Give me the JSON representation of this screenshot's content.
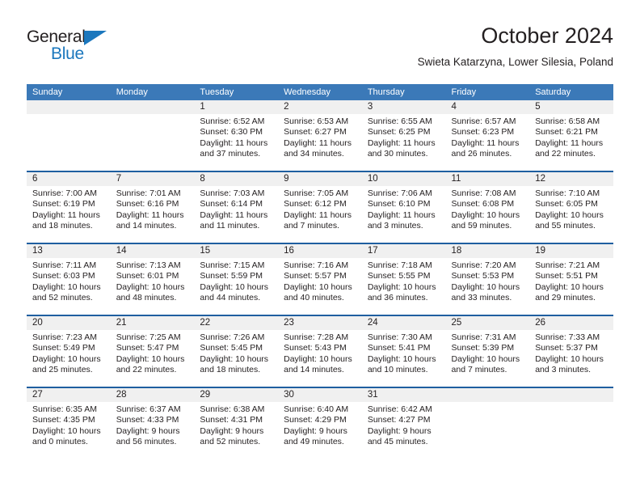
{
  "brand": {
    "name_part1": "General",
    "name_part2": "Blue",
    "logo_icon": "triangle-icon"
  },
  "header": {
    "title": "October 2024",
    "subtitle": "Swieta Katarzyna, Lower Silesia, Poland"
  },
  "colors": {
    "header_blue": "#3b79b8",
    "rule_blue": "#1f5fa0",
    "daynum_band": "#f0f0f0",
    "brand_blue": "#1b77bd",
    "text": "#231f20"
  },
  "weekdays": [
    "Sunday",
    "Monday",
    "Tuesday",
    "Wednesday",
    "Thursday",
    "Friday",
    "Saturday"
  ],
  "weeks": [
    [
      {
        "day": "",
        "lines": []
      },
      {
        "day": "",
        "lines": []
      },
      {
        "day": "1",
        "lines": [
          "Sunrise: 6:52 AM",
          "Sunset: 6:30 PM",
          "Daylight: 11 hours",
          "and 37 minutes."
        ]
      },
      {
        "day": "2",
        "lines": [
          "Sunrise: 6:53 AM",
          "Sunset: 6:27 PM",
          "Daylight: 11 hours",
          "and 34 minutes."
        ]
      },
      {
        "day": "3",
        "lines": [
          "Sunrise: 6:55 AM",
          "Sunset: 6:25 PM",
          "Daylight: 11 hours",
          "and 30 minutes."
        ]
      },
      {
        "day": "4",
        "lines": [
          "Sunrise: 6:57 AM",
          "Sunset: 6:23 PM",
          "Daylight: 11 hours",
          "and 26 minutes."
        ]
      },
      {
        "day": "5",
        "lines": [
          "Sunrise: 6:58 AM",
          "Sunset: 6:21 PM",
          "Daylight: 11 hours",
          "and 22 minutes."
        ]
      }
    ],
    [
      {
        "day": "6",
        "lines": [
          "Sunrise: 7:00 AM",
          "Sunset: 6:19 PM",
          "Daylight: 11 hours",
          "and 18 minutes."
        ]
      },
      {
        "day": "7",
        "lines": [
          "Sunrise: 7:01 AM",
          "Sunset: 6:16 PM",
          "Daylight: 11 hours",
          "and 14 minutes."
        ]
      },
      {
        "day": "8",
        "lines": [
          "Sunrise: 7:03 AM",
          "Sunset: 6:14 PM",
          "Daylight: 11 hours",
          "and 11 minutes."
        ]
      },
      {
        "day": "9",
        "lines": [
          "Sunrise: 7:05 AM",
          "Sunset: 6:12 PM",
          "Daylight: 11 hours",
          "and 7 minutes."
        ]
      },
      {
        "day": "10",
        "lines": [
          "Sunrise: 7:06 AM",
          "Sunset: 6:10 PM",
          "Daylight: 11 hours",
          "and 3 minutes."
        ]
      },
      {
        "day": "11",
        "lines": [
          "Sunrise: 7:08 AM",
          "Sunset: 6:08 PM",
          "Daylight: 10 hours",
          "and 59 minutes."
        ]
      },
      {
        "day": "12",
        "lines": [
          "Sunrise: 7:10 AM",
          "Sunset: 6:05 PM",
          "Daylight: 10 hours",
          "and 55 minutes."
        ]
      }
    ],
    [
      {
        "day": "13",
        "lines": [
          "Sunrise: 7:11 AM",
          "Sunset: 6:03 PM",
          "Daylight: 10 hours",
          "and 52 minutes."
        ]
      },
      {
        "day": "14",
        "lines": [
          "Sunrise: 7:13 AM",
          "Sunset: 6:01 PM",
          "Daylight: 10 hours",
          "and 48 minutes."
        ]
      },
      {
        "day": "15",
        "lines": [
          "Sunrise: 7:15 AM",
          "Sunset: 5:59 PM",
          "Daylight: 10 hours",
          "and 44 minutes."
        ]
      },
      {
        "day": "16",
        "lines": [
          "Sunrise: 7:16 AM",
          "Sunset: 5:57 PM",
          "Daylight: 10 hours",
          "and 40 minutes."
        ]
      },
      {
        "day": "17",
        "lines": [
          "Sunrise: 7:18 AM",
          "Sunset: 5:55 PM",
          "Daylight: 10 hours",
          "and 36 minutes."
        ]
      },
      {
        "day": "18",
        "lines": [
          "Sunrise: 7:20 AM",
          "Sunset: 5:53 PM",
          "Daylight: 10 hours",
          "and 33 minutes."
        ]
      },
      {
        "day": "19",
        "lines": [
          "Sunrise: 7:21 AM",
          "Sunset: 5:51 PM",
          "Daylight: 10 hours",
          "and 29 minutes."
        ]
      }
    ],
    [
      {
        "day": "20",
        "lines": [
          "Sunrise: 7:23 AM",
          "Sunset: 5:49 PM",
          "Daylight: 10 hours",
          "and 25 minutes."
        ]
      },
      {
        "day": "21",
        "lines": [
          "Sunrise: 7:25 AM",
          "Sunset: 5:47 PM",
          "Daylight: 10 hours",
          "and 22 minutes."
        ]
      },
      {
        "day": "22",
        "lines": [
          "Sunrise: 7:26 AM",
          "Sunset: 5:45 PM",
          "Daylight: 10 hours",
          "and 18 minutes."
        ]
      },
      {
        "day": "23",
        "lines": [
          "Sunrise: 7:28 AM",
          "Sunset: 5:43 PM",
          "Daylight: 10 hours",
          "and 14 minutes."
        ]
      },
      {
        "day": "24",
        "lines": [
          "Sunrise: 7:30 AM",
          "Sunset: 5:41 PM",
          "Daylight: 10 hours",
          "and 10 minutes."
        ]
      },
      {
        "day": "25",
        "lines": [
          "Sunrise: 7:31 AM",
          "Sunset: 5:39 PM",
          "Daylight: 10 hours",
          "and 7 minutes."
        ]
      },
      {
        "day": "26",
        "lines": [
          "Sunrise: 7:33 AM",
          "Sunset: 5:37 PM",
          "Daylight: 10 hours",
          "and 3 minutes."
        ]
      }
    ],
    [
      {
        "day": "27",
        "lines": [
          "Sunrise: 6:35 AM",
          "Sunset: 4:35 PM",
          "Daylight: 10 hours",
          "and 0 minutes."
        ]
      },
      {
        "day": "28",
        "lines": [
          "Sunrise: 6:37 AM",
          "Sunset: 4:33 PM",
          "Daylight: 9 hours",
          "and 56 minutes."
        ]
      },
      {
        "day": "29",
        "lines": [
          "Sunrise: 6:38 AM",
          "Sunset: 4:31 PM",
          "Daylight: 9 hours",
          "and 52 minutes."
        ]
      },
      {
        "day": "30",
        "lines": [
          "Sunrise: 6:40 AM",
          "Sunset: 4:29 PM",
          "Daylight: 9 hours",
          "and 49 minutes."
        ]
      },
      {
        "day": "31",
        "lines": [
          "Sunrise: 6:42 AM",
          "Sunset: 4:27 PM",
          "Daylight: 9 hours",
          "and 45 minutes."
        ]
      },
      {
        "day": "",
        "lines": []
      },
      {
        "day": "",
        "lines": []
      }
    ]
  ]
}
